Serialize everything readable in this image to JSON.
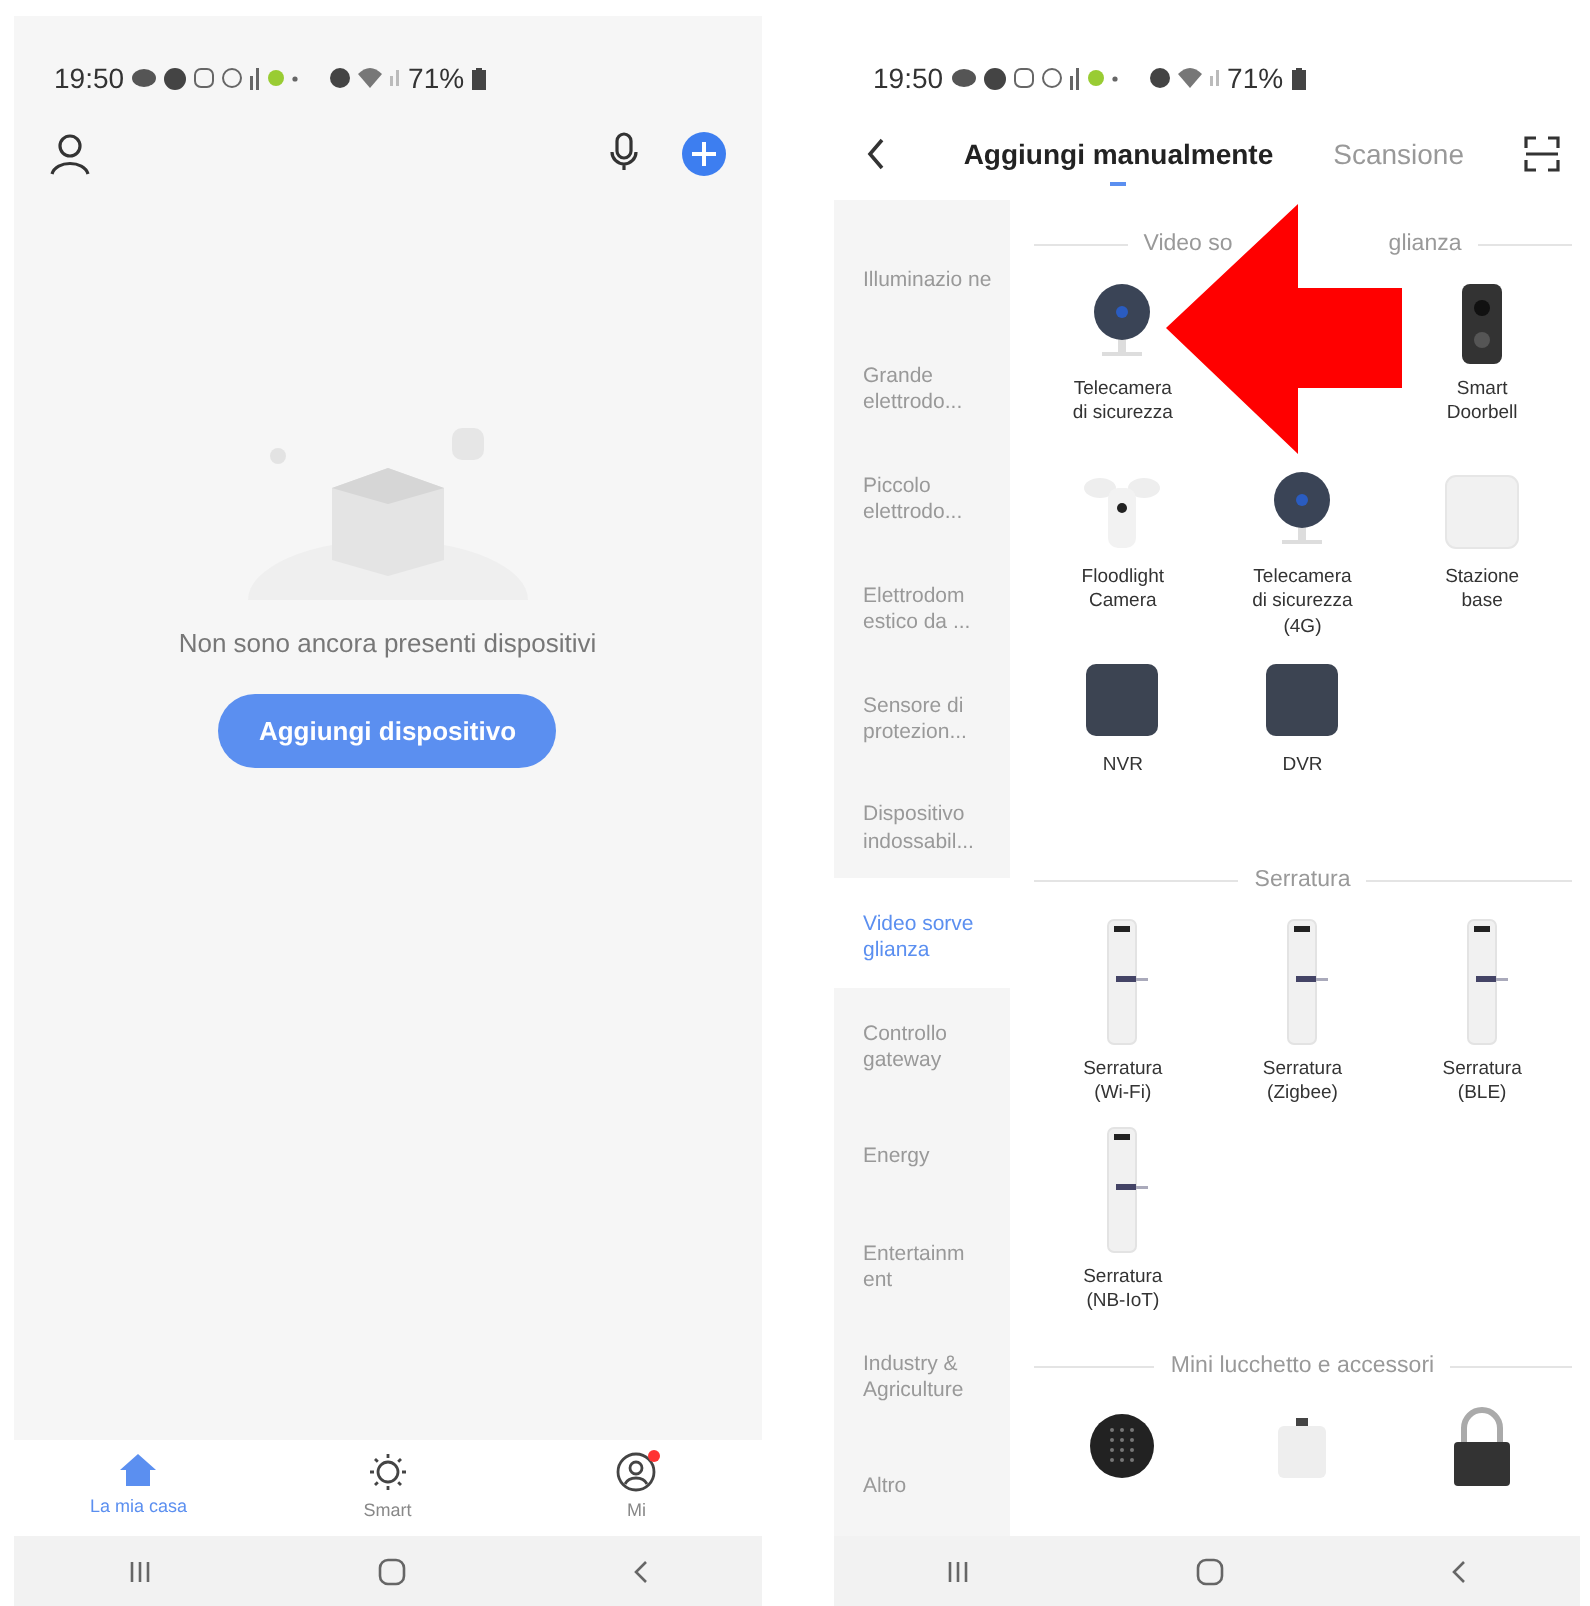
{
  "home_screen": {
    "status_bar": {
      "time": "19:50",
      "battery": "71%"
    },
    "empty_message": "Non sono ancora presenti dispositivi",
    "add_button": "Aggiungi dispositivo",
    "tabs": [
      {
        "label": "La mia casa",
        "selected": true,
        "badge": false
      },
      {
        "label": "Smart",
        "selected": false,
        "badge": false
      },
      {
        "label": "Mi",
        "selected": false,
        "badge": true
      }
    ]
  },
  "add_screen": {
    "status_bar": {
      "time": "19:50",
      "battery": "71%"
    },
    "tabs": [
      {
        "label": "Aggiungi manualmente",
        "selected": true
      },
      {
        "label": "Scansione",
        "selected": false
      }
    ],
    "categories": [
      {
        "label": "Illuminazio ne",
        "selected": false
      },
      {
        "label": "Grande elettrodo...",
        "selected": false
      },
      {
        "label": "Piccolo elettrodo...",
        "selected": false
      },
      {
        "label": "Elettrodom estico da ...",
        "selected": false
      },
      {
        "label": "Sensore di protezion...",
        "selected": false
      },
      {
        "label": "Dispositivo indossabil...",
        "selected": false
      },
      {
        "label": "Video sorve glianza",
        "selected": true
      },
      {
        "label": "Controllo gateway",
        "selected": false
      },
      {
        "label": "Energy",
        "selected": false
      },
      {
        "label": "Entertainm ent",
        "selected": false
      },
      {
        "label": "Industry & Agriculture",
        "selected": false
      },
      {
        "label": "Altro",
        "selected": false
      }
    ],
    "sections": [
      {
        "title_parts": [
          "Video so",
          "glianza"
        ],
        "devices": [
          {
            "kind": "camera",
            "label": "Telecamera di sicurezza"
          },
          {
            "kind": "covered"
          },
          {
            "kind": "doorbell",
            "label": "Smart Doorbell"
          },
          {
            "kind": "floodlight",
            "label": "Floodlight Camera"
          },
          {
            "kind": "camera",
            "label": "Telecamera di sicurezza (4G)"
          },
          {
            "kind": "hub",
            "label": "Stazione base"
          },
          {
            "kind": "recorder",
            "label": "NVR"
          },
          {
            "kind": "recorder",
            "label": "DVR"
          }
        ]
      },
      {
        "title_parts": [
          "Serratura"
        ],
        "devices": [
          {
            "kind": "lock",
            "label": "Serratura (Wi-Fi)"
          },
          {
            "kind": "lock",
            "label": "Serratura (Zigbee)"
          },
          {
            "kind": "lock",
            "label": "Serratura (BLE)"
          },
          {
            "kind": "lock",
            "label": "Serratura (NB-IoT)"
          }
        ]
      },
      {
        "title_parts": [
          "Mini lucchetto e accessori"
        ],
        "devices": [
          {
            "kind": "keypad"
          },
          {
            "kind": "tag"
          },
          {
            "kind": "padlock"
          }
        ]
      }
    ]
  }
}
